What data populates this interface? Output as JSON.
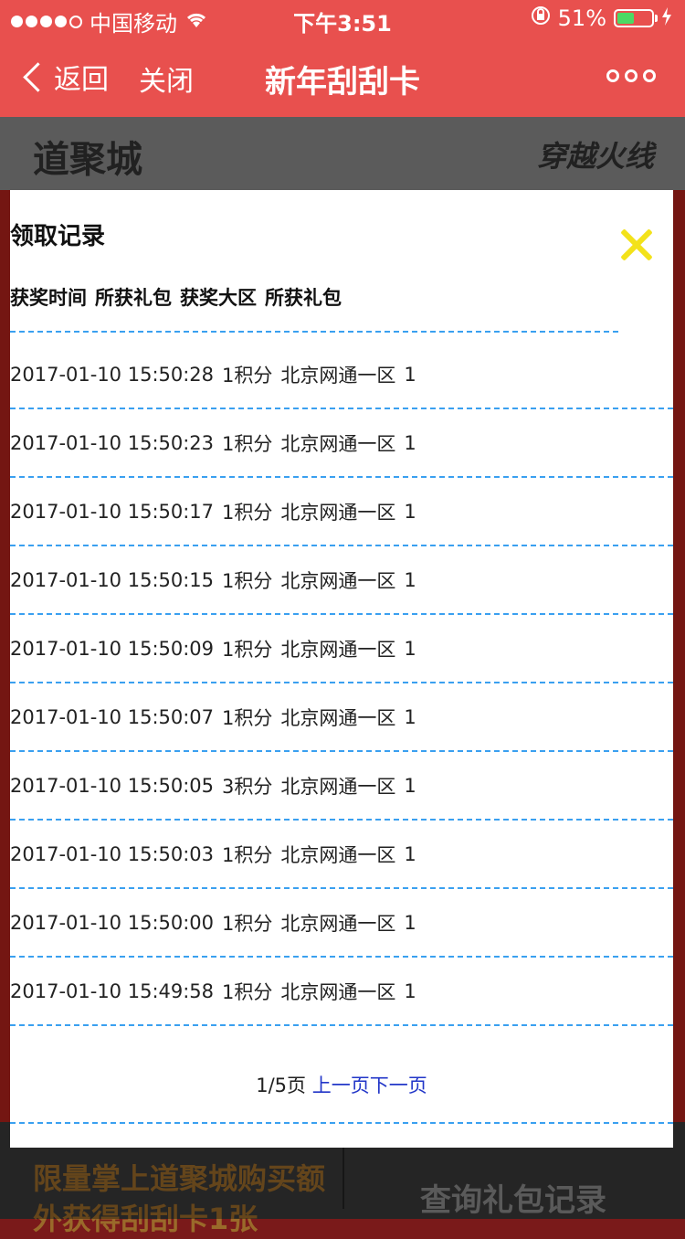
{
  "status_bar": {
    "carrier": "中国移动",
    "time": "下午3:51",
    "battery_percent": "51%",
    "battery_level": 0.51
  },
  "nav": {
    "back_label": "返回",
    "close_label": "关闭",
    "title": "新年刮刮卡"
  },
  "background": {
    "logo_left": "道聚城",
    "logo_right": "穿越火线",
    "bottom_left": "限量掌上道聚城购买额外获得刮刮卡1张",
    "bottom_right": "查询礼包记录"
  },
  "modal": {
    "title": "领取记录",
    "columns": [
      "获奖时间",
      "所获礼包",
      "获奖大区",
      "所获礼包"
    ],
    "records": [
      {
        "time": "2017-01-10 15:50:28",
        "reward": "1积分",
        "region": "北京网通一区",
        "count": "1"
      },
      {
        "time": "2017-01-10 15:50:23",
        "reward": "1积分",
        "region": "北京网通一区",
        "count": "1"
      },
      {
        "time": "2017-01-10 15:50:17",
        "reward": "1积分",
        "region": "北京网通一区",
        "count": "1"
      },
      {
        "time": "2017-01-10 15:50:15",
        "reward": "1积分",
        "region": "北京网通一区",
        "count": "1"
      },
      {
        "time": "2017-01-10 15:50:09",
        "reward": "1积分",
        "region": "北京网通一区",
        "count": "1"
      },
      {
        "time": "2017-01-10 15:50:07",
        "reward": "1积分",
        "region": "北京网通一区",
        "count": "1"
      },
      {
        "time": "2017-01-10 15:50:05",
        "reward": "3积分",
        "region": "北京网通一区",
        "count": "1"
      },
      {
        "time": "2017-01-10 15:50:03",
        "reward": "1积分",
        "region": "北京网通一区",
        "count": "1"
      },
      {
        "time": "2017-01-10 15:50:00",
        "reward": "1积分",
        "region": "北京网通一区",
        "count": "1"
      },
      {
        "time": "2017-01-10 15:49:58",
        "reward": "1积分",
        "region": "北京网通一区",
        "count": "1"
      }
    ],
    "pager": {
      "page_info": "1/5页",
      "prev_label": "上一页",
      "next_label": "下一页"
    }
  },
  "colors": {
    "accent": "#e8504e",
    "divider": "#3aa0f0",
    "link": "#2236c8",
    "close_icon": "#f3e21a"
  }
}
